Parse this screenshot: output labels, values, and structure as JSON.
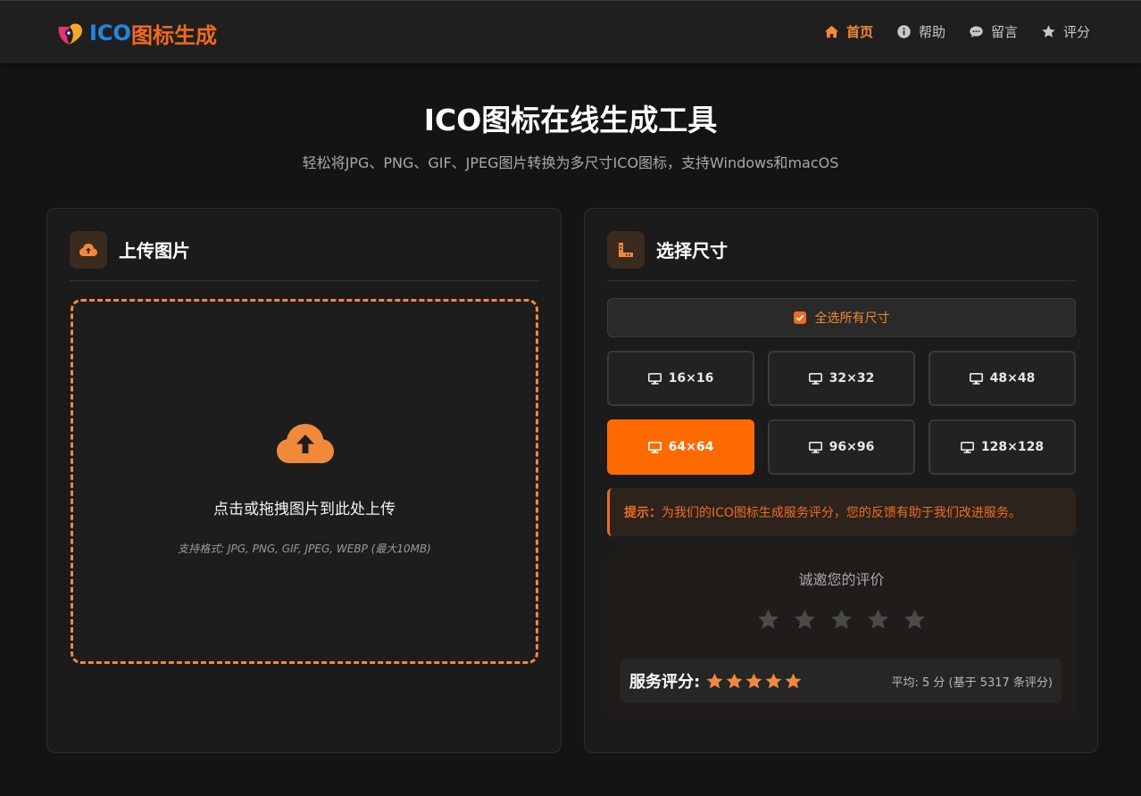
{
  "brand": {
    "logo_ico": "ICO",
    "logo_cn": "图标生成"
  },
  "nav": [
    {
      "label": "首页",
      "icon": "home-icon",
      "active": true
    },
    {
      "label": "帮助",
      "icon": "info-icon",
      "active": false
    },
    {
      "label": "留言",
      "icon": "comment-icon",
      "active": false
    },
    {
      "label": "评分",
      "icon": "star-icon",
      "active": false
    }
  ],
  "hero": {
    "title": "ICO图标在线生成工具",
    "subtitle": "轻松将JPG、PNG、GIF、JPEG图片转换为多尺寸ICO图标，支持Windows和macOS"
  },
  "upload": {
    "title": "上传图片",
    "drop_text": "点击或拖拽图片到此处上传",
    "formats_text": "支持格式: JPG, PNG, GIF, JPEG, WEBP (最大10MB)"
  },
  "sizes": {
    "title": "选择尺寸",
    "select_all_label": "全选所有尺寸",
    "options": [
      {
        "label": "16×16",
        "selected": false
      },
      {
        "label": "32×32",
        "selected": false
      },
      {
        "label": "48×48",
        "selected": false
      },
      {
        "label": "64×64",
        "selected": true
      },
      {
        "label": "96×96",
        "selected": false
      },
      {
        "label": "128×128",
        "selected": false
      }
    ]
  },
  "tip": {
    "label": "提示：",
    "text": "为我们的ICO图标生成服务评分，您的反馈有助于我们改进服务。"
  },
  "rating": {
    "prompt": "诚邀您的评价",
    "input_stars": 5,
    "score_label": "服务评分:",
    "score_value": 5,
    "average_text": "平均: 5 分 (基于 5317 条评分)"
  },
  "colors": {
    "accent": "#f26b1d",
    "accent_bright": "#ff6a00",
    "logo_blue": "#1e88e5",
    "background": "#141414"
  }
}
